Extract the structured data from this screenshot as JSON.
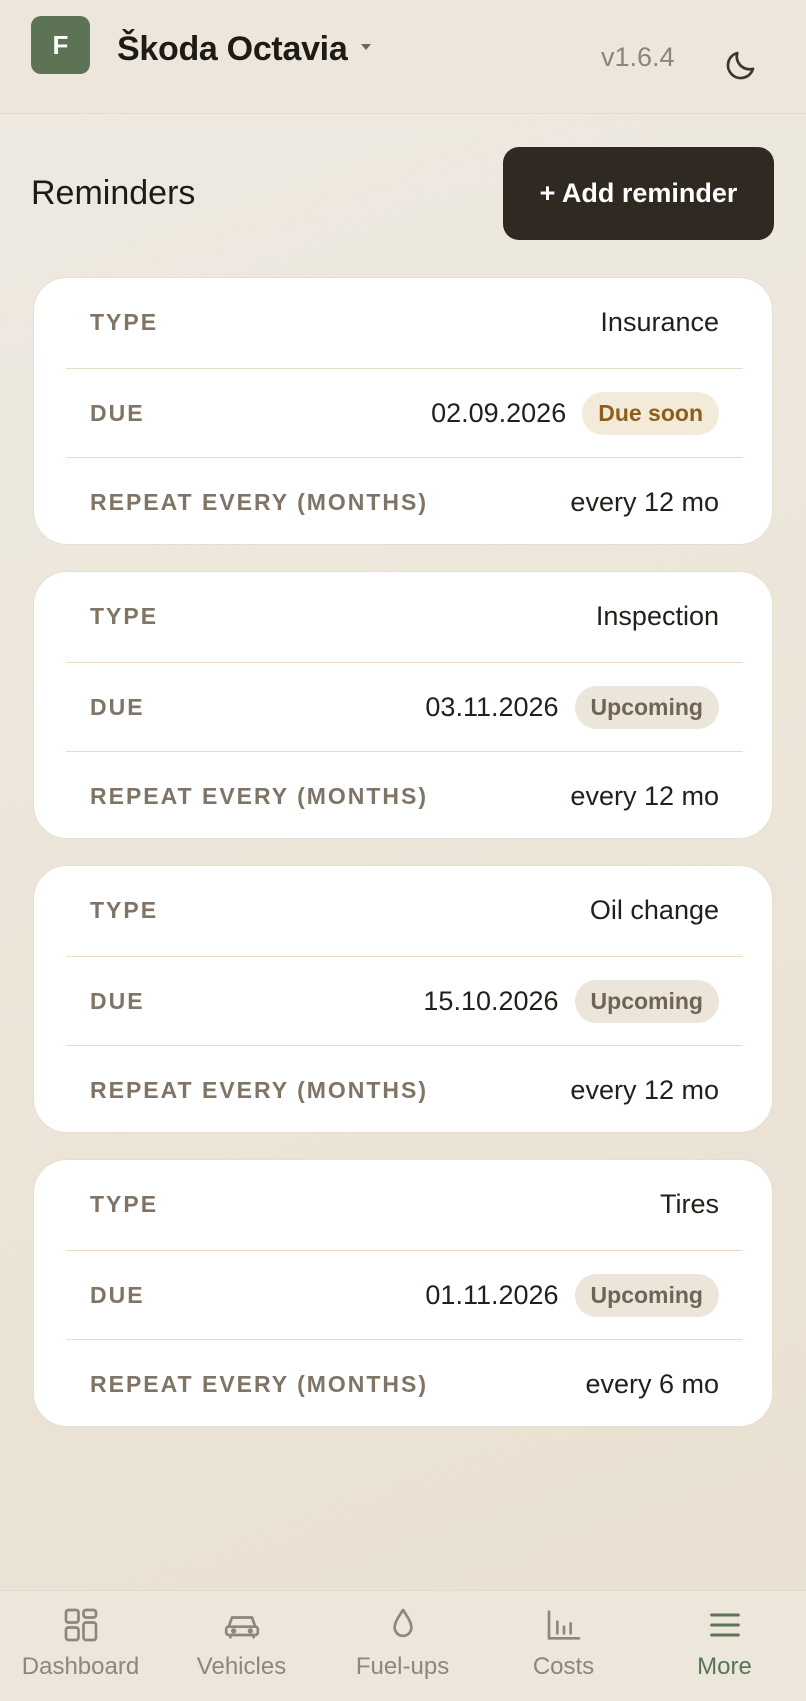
{
  "header": {
    "avatar_letter": "F",
    "vehicle_name": "Škoda Octavia",
    "version": "v1.6.4",
    "theme_icon": "moon-icon"
  },
  "page": {
    "title": "Reminders",
    "add_button": "+ Add reminder"
  },
  "labels": {
    "type": "TYPE",
    "due": "DUE",
    "repeat": "REPEAT EVERY (MONTHS)"
  },
  "reminders": [
    {
      "type": "Insurance",
      "due": "02.09.2026",
      "status": "Due soon",
      "repeat": "every 12 mo"
    },
    {
      "type": "Inspection",
      "due": "03.11.2026",
      "status": "Upcoming",
      "repeat": "every 12 mo"
    },
    {
      "type": "Oil change",
      "due": "15.10.2026",
      "status": "Upcoming",
      "repeat": "every 12 mo"
    },
    {
      "type": "Tires",
      "due": "01.11.2026",
      "status": "Upcoming",
      "repeat": "every 6 mo"
    }
  ],
  "nav": [
    {
      "label": "Dashboard",
      "icon": "dashboard-icon",
      "active": false
    },
    {
      "label": "Vehicles",
      "icon": "car-icon",
      "active": false
    },
    {
      "label": "Fuel-ups",
      "icon": "drop-icon",
      "active": false
    },
    {
      "label": "Costs",
      "icon": "bar-chart-icon",
      "active": false
    },
    {
      "label": "More",
      "icon": "menu-icon",
      "active": true
    }
  ],
  "colors": {
    "accent": "#5d7356",
    "button_dark": "#2f2922",
    "badge_soon_bg": "#f3ead9",
    "badge_soon_text": "#8c5f1a",
    "badge_upcoming_bg": "#ece5d9"
  }
}
